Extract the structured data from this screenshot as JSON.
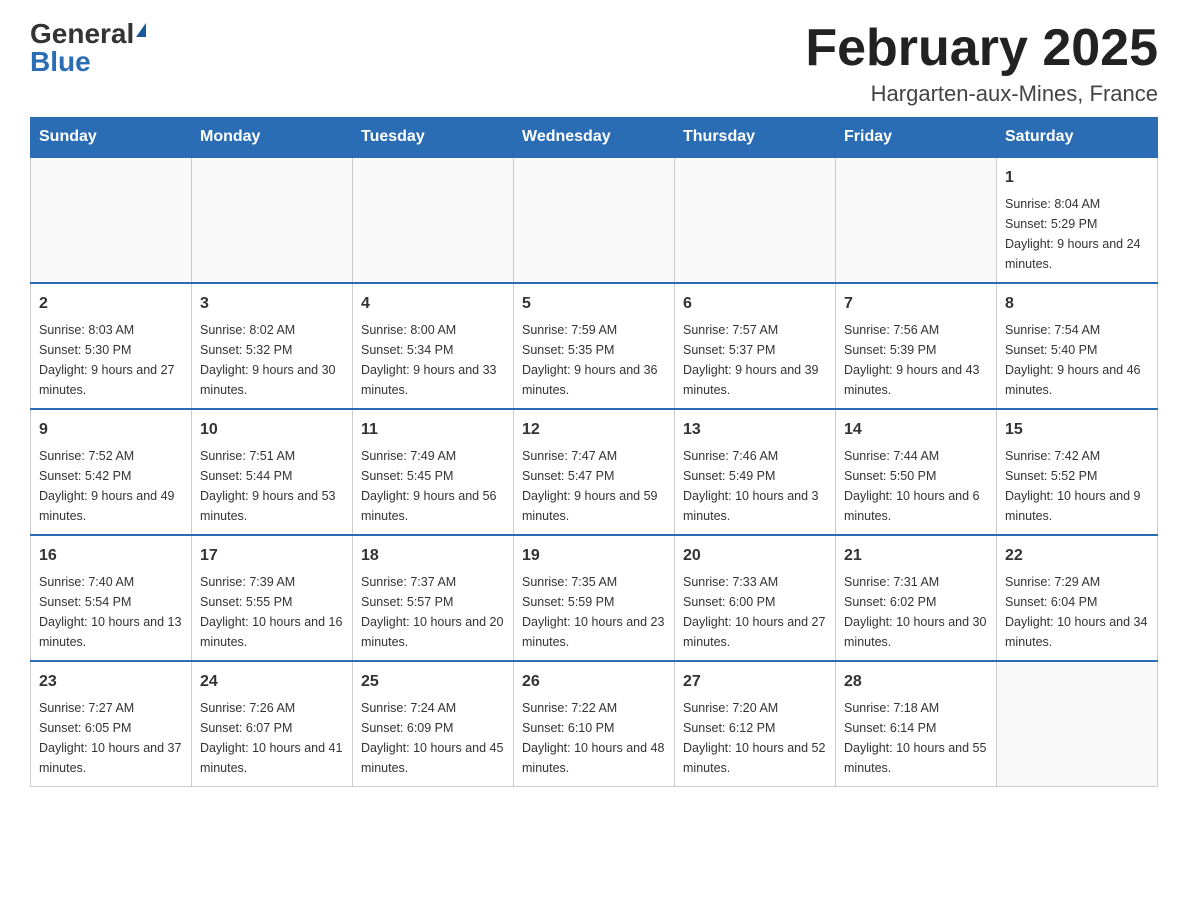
{
  "header": {
    "logo_general": "General",
    "logo_blue": "Blue",
    "month_title": "February 2025",
    "location": "Hargarten-aux-Mines, France"
  },
  "days_of_week": [
    "Sunday",
    "Monday",
    "Tuesday",
    "Wednesday",
    "Thursday",
    "Friday",
    "Saturday"
  ],
  "weeks": [
    [
      {
        "day": "",
        "info": ""
      },
      {
        "day": "",
        "info": ""
      },
      {
        "day": "",
        "info": ""
      },
      {
        "day": "",
        "info": ""
      },
      {
        "day": "",
        "info": ""
      },
      {
        "day": "",
        "info": ""
      },
      {
        "day": "1",
        "info": "Sunrise: 8:04 AM\nSunset: 5:29 PM\nDaylight: 9 hours and 24 minutes."
      }
    ],
    [
      {
        "day": "2",
        "info": "Sunrise: 8:03 AM\nSunset: 5:30 PM\nDaylight: 9 hours and 27 minutes."
      },
      {
        "day": "3",
        "info": "Sunrise: 8:02 AM\nSunset: 5:32 PM\nDaylight: 9 hours and 30 minutes."
      },
      {
        "day": "4",
        "info": "Sunrise: 8:00 AM\nSunset: 5:34 PM\nDaylight: 9 hours and 33 minutes."
      },
      {
        "day": "5",
        "info": "Sunrise: 7:59 AM\nSunset: 5:35 PM\nDaylight: 9 hours and 36 minutes."
      },
      {
        "day": "6",
        "info": "Sunrise: 7:57 AM\nSunset: 5:37 PM\nDaylight: 9 hours and 39 minutes."
      },
      {
        "day": "7",
        "info": "Sunrise: 7:56 AM\nSunset: 5:39 PM\nDaylight: 9 hours and 43 minutes."
      },
      {
        "day": "8",
        "info": "Sunrise: 7:54 AM\nSunset: 5:40 PM\nDaylight: 9 hours and 46 minutes."
      }
    ],
    [
      {
        "day": "9",
        "info": "Sunrise: 7:52 AM\nSunset: 5:42 PM\nDaylight: 9 hours and 49 minutes."
      },
      {
        "day": "10",
        "info": "Sunrise: 7:51 AM\nSunset: 5:44 PM\nDaylight: 9 hours and 53 minutes."
      },
      {
        "day": "11",
        "info": "Sunrise: 7:49 AM\nSunset: 5:45 PM\nDaylight: 9 hours and 56 minutes."
      },
      {
        "day": "12",
        "info": "Sunrise: 7:47 AM\nSunset: 5:47 PM\nDaylight: 9 hours and 59 minutes."
      },
      {
        "day": "13",
        "info": "Sunrise: 7:46 AM\nSunset: 5:49 PM\nDaylight: 10 hours and 3 minutes."
      },
      {
        "day": "14",
        "info": "Sunrise: 7:44 AM\nSunset: 5:50 PM\nDaylight: 10 hours and 6 minutes."
      },
      {
        "day": "15",
        "info": "Sunrise: 7:42 AM\nSunset: 5:52 PM\nDaylight: 10 hours and 9 minutes."
      }
    ],
    [
      {
        "day": "16",
        "info": "Sunrise: 7:40 AM\nSunset: 5:54 PM\nDaylight: 10 hours and 13 minutes."
      },
      {
        "day": "17",
        "info": "Sunrise: 7:39 AM\nSunset: 5:55 PM\nDaylight: 10 hours and 16 minutes."
      },
      {
        "day": "18",
        "info": "Sunrise: 7:37 AM\nSunset: 5:57 PM\nDaylight: 10 hours and 20 minutes."
      },
      {
        "day": "19",
        "info": "Sunrise: 7:35 AM\nSunset: 5:59 PM\nDaylight: 10 hours and 23 minutes."
      },
      {
        "day": "20",
        "info": "Sunrise: 7:33 AM\nSunset: 6:00 PM\nDaylight: 10 hours and 27 minutes."
      },
      {
        "day": "21",
        "info": "Sunrise: 7:31 AM\nSunset: 6:02 PM\nDaylight: 10 hours and 30 minutes."
      },
      {
        "day": "22",
        "info": "Sunrise: 7:29 AM\nSunset: 6:04 PM\nDaylight: 10 hours and 34 minutes."
      }
    ],
    [
      {
        "day": "23",
        "info": "Sunrise: 7:27 AM\nSunset: 6:05 PM\nDaylight: 10 hours and 37 minutes."
      },
      {
        "day": "24",
        "info": "Sunrise: 7:26 AM\nSunset: 6:07 PM\nDaylight: 10 hours and 41 minutes."
      },
      {
        "day": "25",
        "info": "Sunrise: 7:24 AM\nSunset: 6:09 PM\nDaylight: 10 hours and 45 minutes."
      },
      {
        "day": "26",
        "info": "Sunrise: 7:22 AM\nSunset: 6:10 PM\nDaylight: 10 hours and 48 minutes."
      },
      {
        "day": "27",
        "info": "Sunrise: 7:20 AM\nSunset: 6:12 PM\nDaylight: 10 hours and 52 minutes."
      },
      {
        "day": "28",
        "info": "Sunrise: 7:18 AM\nSunset: 6:14 PM\nDaylight: 10 hours and 55 minutes."
      },
      {
        "day": "",
        "info": ""
      }
    ]
  ]
}
